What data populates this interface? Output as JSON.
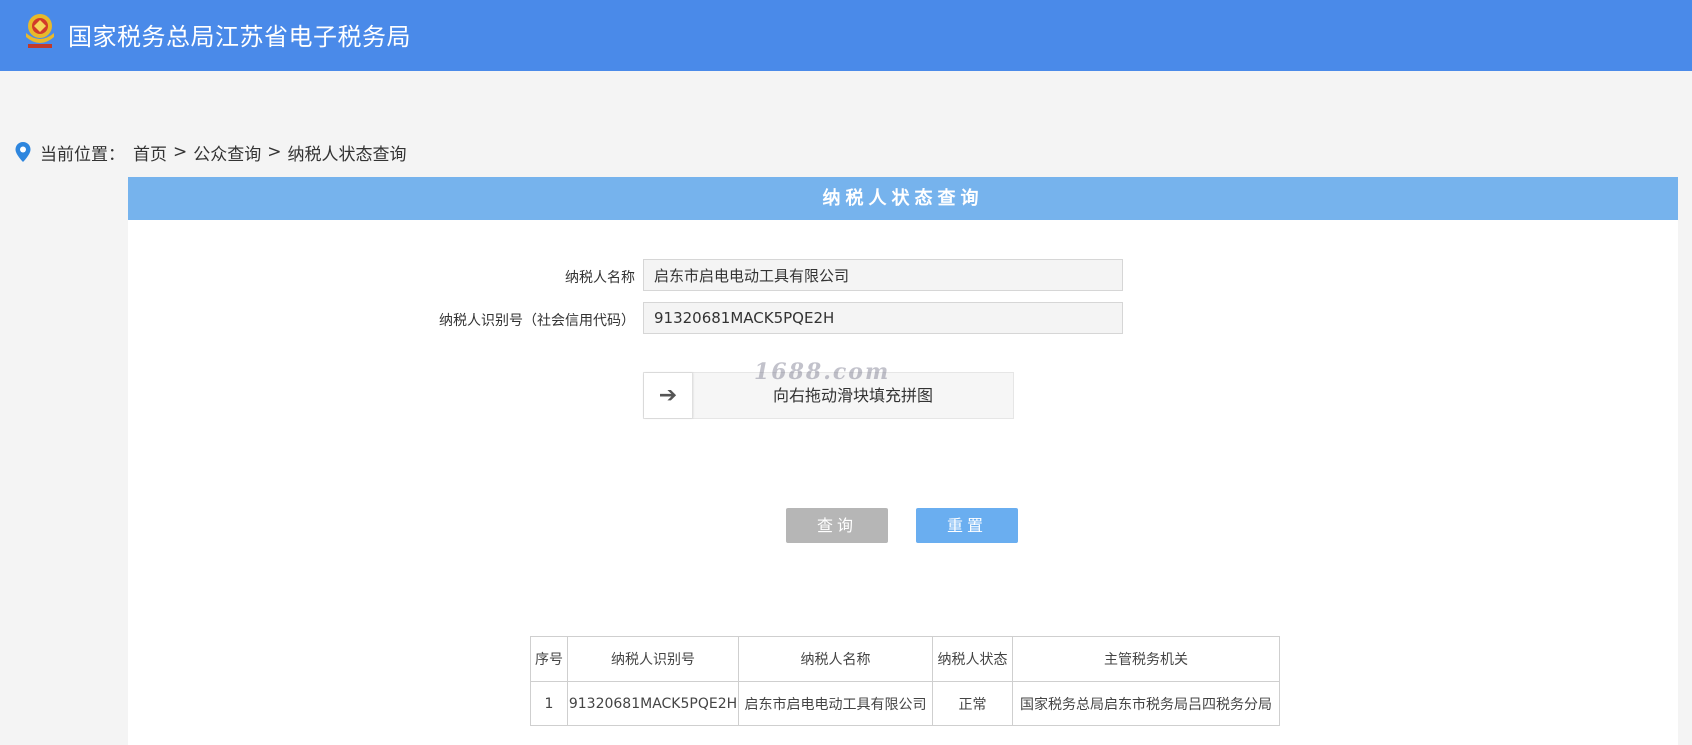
{
  "header": {
    "title": "国家税务总局江苏省电子税务局",
    "emblem_icon": "tax-emblem-icon"
  },
  "breadcrumb": {
    "label": "当前位置：",
    "items": [
      "首页",
      "公众查询",
      "纳税人状态查询"
    ],
    "separator": ">"
  },
  "panel": {
    "title": "纳税人状态查询"
  },
  "form": {
    "name_label": "纳税人名称",
    "name_value": "启东市启电电动工具有限公司",
    "id_label": "纳税人识别号（社会信用代码）",
    "id_value": "91320681MACK5PQE2H",
    "slider_text": "向右拖动滑块填充拼图",
    "slider_icon": "arrow-right-icon"
  },
  "watermark": "1688.com",
  "buttons": {
    "query": "查询",
    "reset": "重置"
  },
  "results": {
    "headers": [
      "序号",
      "纳税人识别号",
      "纳税人名称",
      "纳税人状态",
      "主管税务机关"
    ],
    "rows": [
      [
        "1",
        "91320681MACK5PQE2H",
        "启东市启电电动工具有限公司",
        "正常",
        "国家税务总局启东市税务局吕四税务分局"
      ]
    ]
  },
  "colors": {
    "topbar": "#4a8ae9",
    "panel_header": "#76b3ed",
    "query_button": "#b6b6b6",
    "reset_button": "#6aaef0"
  }
}
